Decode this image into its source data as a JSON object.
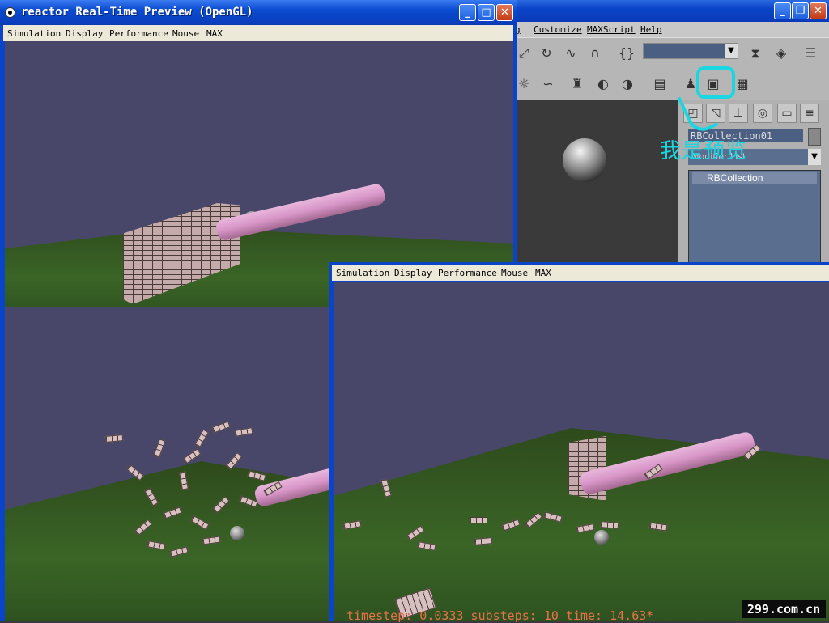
{
  "max_window": {
    "menu": [
      "g",
      "Customize",
      "MAXScript",
      "Help"
    ],
    "toolbar_icons": [
      "select-move-icon",
      "rotate-icon",
      "snap-icon",
      "magnet-icon",
      "curly-icon",
      "mirror-icon",
      "align-icon",
      "layers-icon"
    ],
    "named_selection_value": "",
    "render_icons": [
      "material-editor-icon",
      "render-scene-icon",
      "quick-render-icon"
    ],
    "object_name": "RBCollection01",
    "modifier_list_label": "Modifier List",
    "modifier_stack_item": "RBCollection"
  },
  "annotation": {
    "text": "我是预览",
    "color": "#1ad6e0"
  },
  "reactor_window": {
    "title": "reactor Real-Time Preview (OpenGL)",
    "menu": [
      "Simulation",
      "Display",
      "Performance",
      "Mouse",
      "MAX"
    ]
  },
  "reactor_window2": {
    "menu": [
      "Simulation",
      "Display",
      "Performance",
      "Mouse",
      "MAX"
    ],
    "status": "timestep: 0.0333 substeps: 10 time: 14.63*"
  },
  "watermark": "299.com.cn",
  "colors": {
    "sky": "#48476a",
    "ground": "#3a6526",
    "pipe": "#d896c8",
    "xp_blue": "#0a44c8",
    "status_text": "#e8724a"
  }
}
